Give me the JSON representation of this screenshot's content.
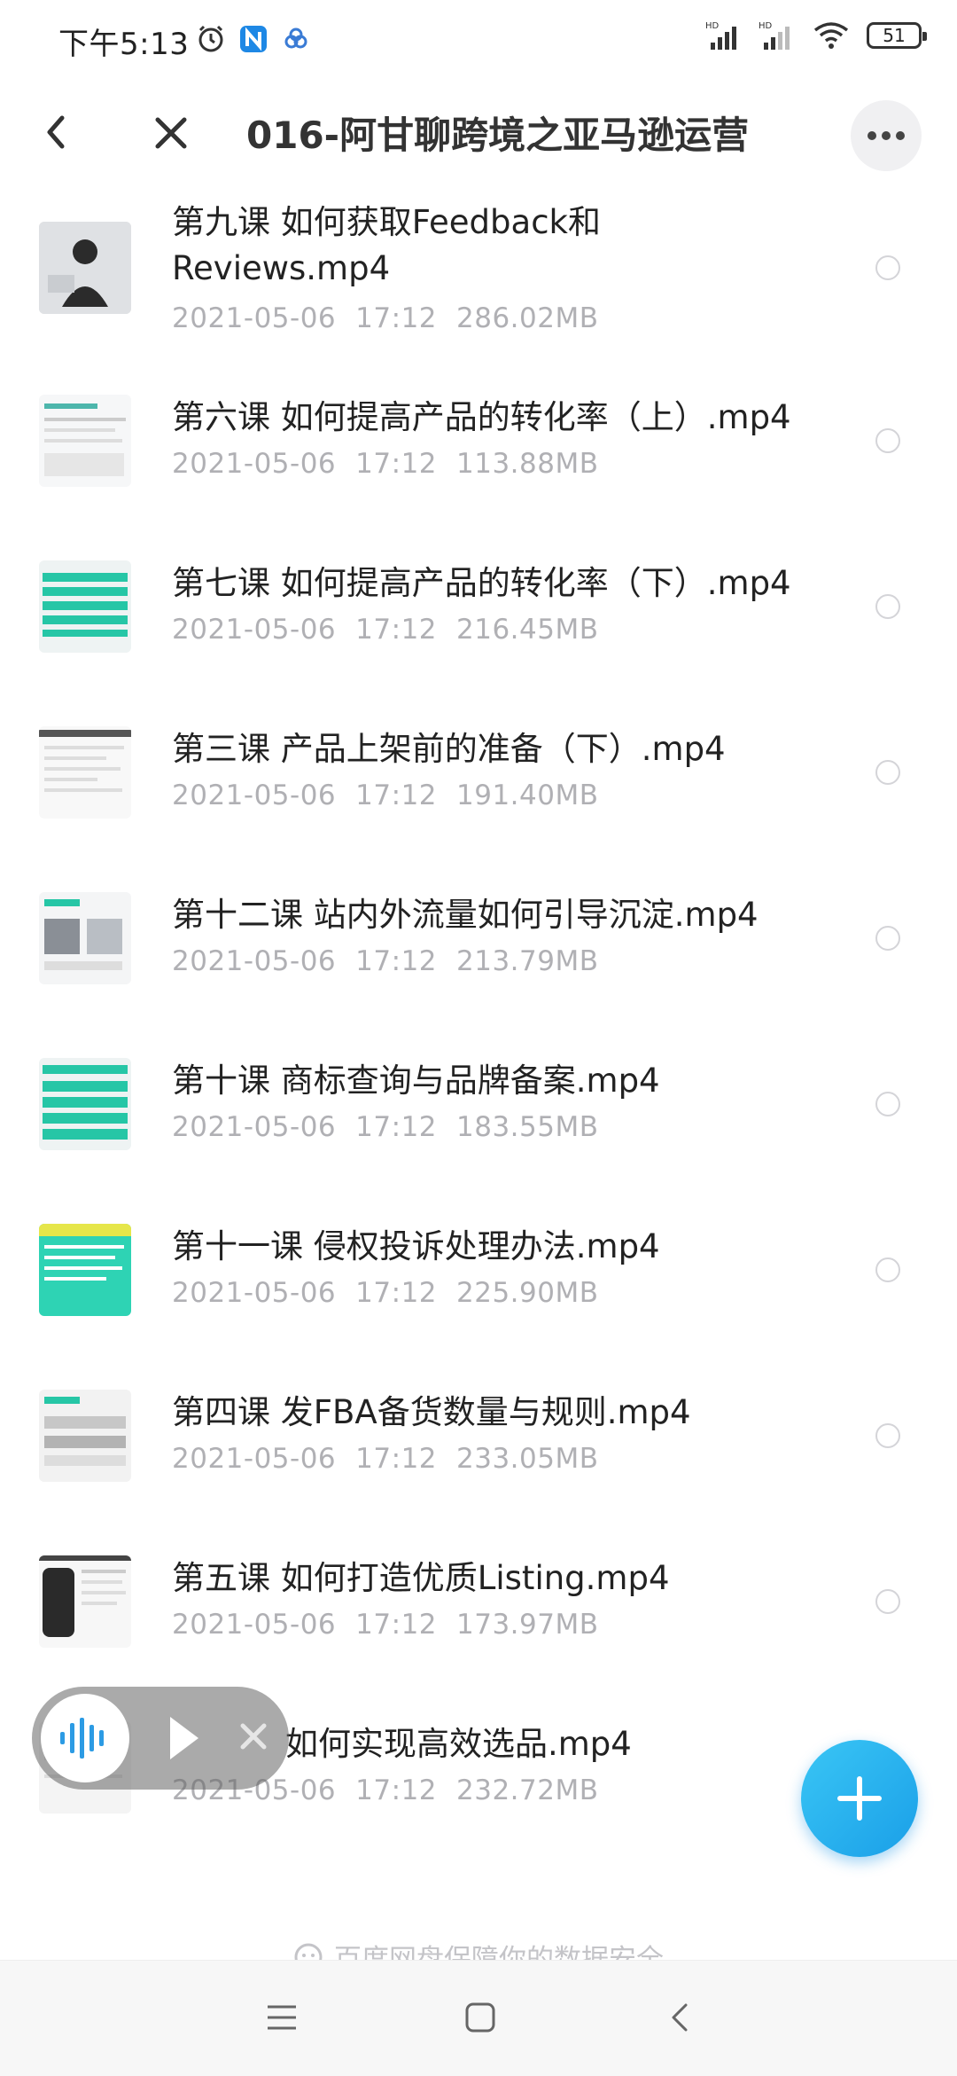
{
  "status": {
    "time": "下午5:13",
    "battery": "51",
    "left_icons": [
      "alarm-icon",
      "n-app-icon",
      "baidu-cloud-icon"
    ],
    "right_icons": [
      "hd-signal-icon",
      "hd-signal-icon",
      "wifi-icon",
      "battery-icon"
    ]
  },
  "header": {
    "title": "016-阿甘聊跨境之亚马逊运营",
    "back_icon": "chevron-left-icon",
    "close_icon": "close-icon",
    "more_icon": "more-icon"
  },
  "files": [
    {
      "name": "第九课 如何获取Feedback和Reviews.mp4",
      "date": "2021-05-06",
      "time": "17:12",
      "size": "286.02MB"
    },
    {
      "name": "第六课 如何提高产品的转化率（上）.mp4",
      "date": "2021-05-06",
      "time": "17:12",
      "size": "113.88MB"
    },
    {
      "name": "第七课 如何提高产品的转化率（下）.mp4",
      "date": "2021-05-06",
      "time": "17:12",
      "size": "216.45MB"
    },
    {
      "name": "第三课 产品上架前的准备（下）.mp4",
      "date": "2021-05-06",
      "time": "17:12",
      "size": "191.40MB"
    },
    {
      "name": "第十二课 站内外流量如何引导沉淀.mp4",
      "date": "2021-05-06",
      "time": "17:12",
      "size": "213.79MB"
    },
    {
      "name": "第十课 商标查询与品牌备案.mp4",
      "date": "2021-05-06",
      "time": "17:12",
      "size": "183.55MB"
    },
    {
      "name": "第十一课 侵权投诉处理办法.mp4",
      "date": "2021-05-06",
      "time": "17:12",
      "size": "225.90MB"
    },
    {
      "name": "第四课 发FBA备货数量与规则.mp4",
      "date": "2021-05-06",
      "time": "17:12",
      "size": "233.05MB"
    },
    {
      "name": "第五课 如何打造优质Listing.mp4",
      "date": "2021-05-06",
      "time": "17:12",
      "size": "173.97MB"
    },
    {
      "name": "如何实现高效选品.mp4",
      "date": "2021-05-06",
      "time": "17:12",
      "size": "232.72MB"
    }
  ],
  "footer": {
    "safety_note": "百度网盘保障你的数据安全"
  },
  "colors": {
    "accent": "#1a9fe8",
    "meta_text": "#b0b0b4"
  }
}
